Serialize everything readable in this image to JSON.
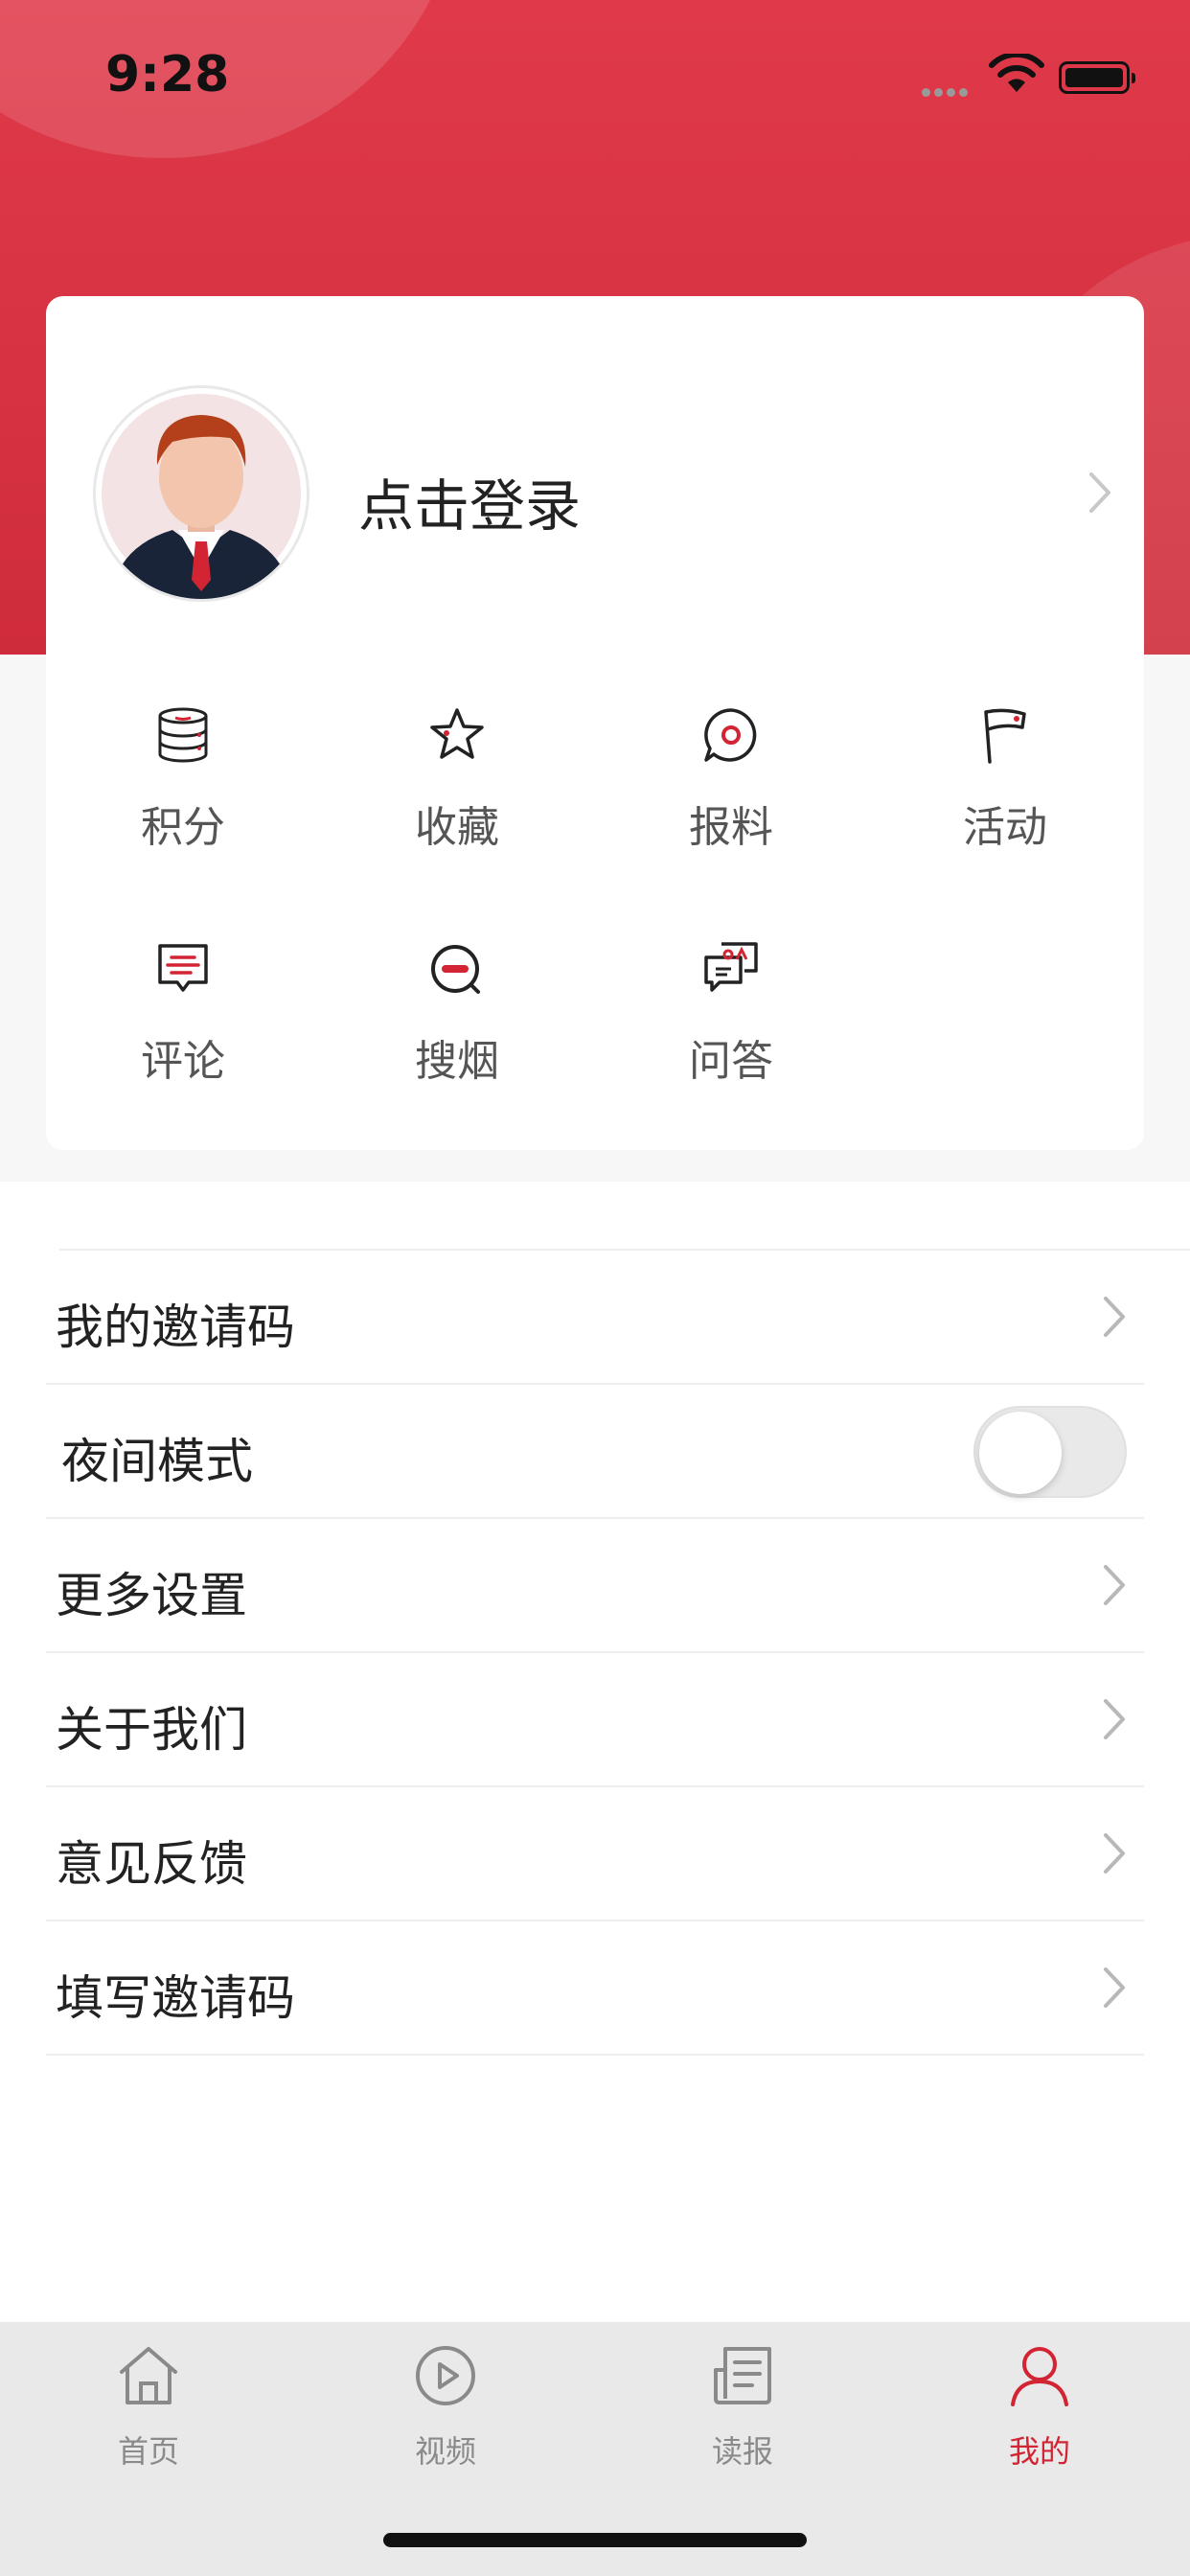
{
  "status_bar": {
    "time": "9:28"
  },
  "profile": {
    "login_label": "点击登录"
  },
  "features": [
    {
      "label": "积分",
      "icon": "database-coins-icon"
    },
    {
      "label": "收藏",
      "icon": "star-icon"
    },
    {
      "label": "报料",
      "icon": "chat-report-icon"
    },
    {
      "label": "活动",
      "icon": "flag-icon"
    },
    {
      "label": "评论",
      "icon": "comment-icon"
    },
    {
      "label": "搜烟",
      "icon": "search-minus-icon"
    },
    {
      "label": "问答",
      "icon": "qa-chat-icon"
    }
  ],
  "menu": [
    {
      "label": "我的邀请码"
    },
    {
      "label": "夜间模式",
      "toggle": false
    },
    {
      "label": "更多设置"
    },
    {
      "label": "关于我们"
    },
    {
      "label": "意见反馈"
    },
    {
      "label": "填写邀请码"
    }
  ],
  "tabbar": [
    {
      "label": "首页",
      "icon": "home-icon"
    },
    {
      "label": "视频",
      "icon": "play-icon"
    },
    {
      "label": "读报",
      "icon": "newspaper-icon"
    },
    {
      "label": "我的",
      "icon": "user-icon",
      "active": true
    }
  ],
  "colors": {
    "accent": "#d32433",
    "header": "#d93342"
  }
}
